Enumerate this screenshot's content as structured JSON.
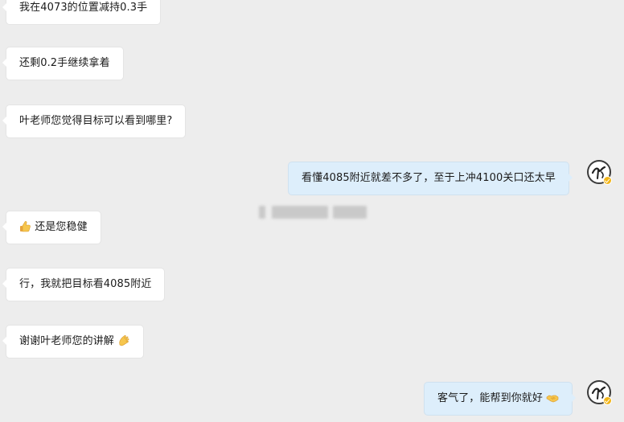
{
  "messages": [
    {
      "side": "in",
      "text": "我在4073的位置减持0.3手"
    },
    {
      "side": "in",
      "text": "还剩0.2手继续拿着"
    },
    {
      "side": "in",
      "text": "叶老师您觉得目标可以看到哪里?"
    },
    {
      "side": "out",
      "text": "看懂4085附近就差不多了，至于上冲4100关口还太早"
    },
    {
      "side": "in",
      "text": "还是您稳健",
      "emoji": "thumbs-up-icon"
    },
    {
      "side": "in",
      "text": "行，我就把目标看4085附近"
    },
    {
      "side": "in",
      "text": "谢谢叶老师您的讲解",
      "emoji": "clapping-hands-icon"
    },
    {
      "side": "out",
      "text": "客气了，能帮到你就好",
      "emoji": "handshake-icon"
    }
  ],
  "colors": {
    "background": "#ededed",
    "incoming_bubble": "#ffffff",
    "outgoing_bubble": "#ddeefb",
    "badge": "#f3b61a"
  }
}
